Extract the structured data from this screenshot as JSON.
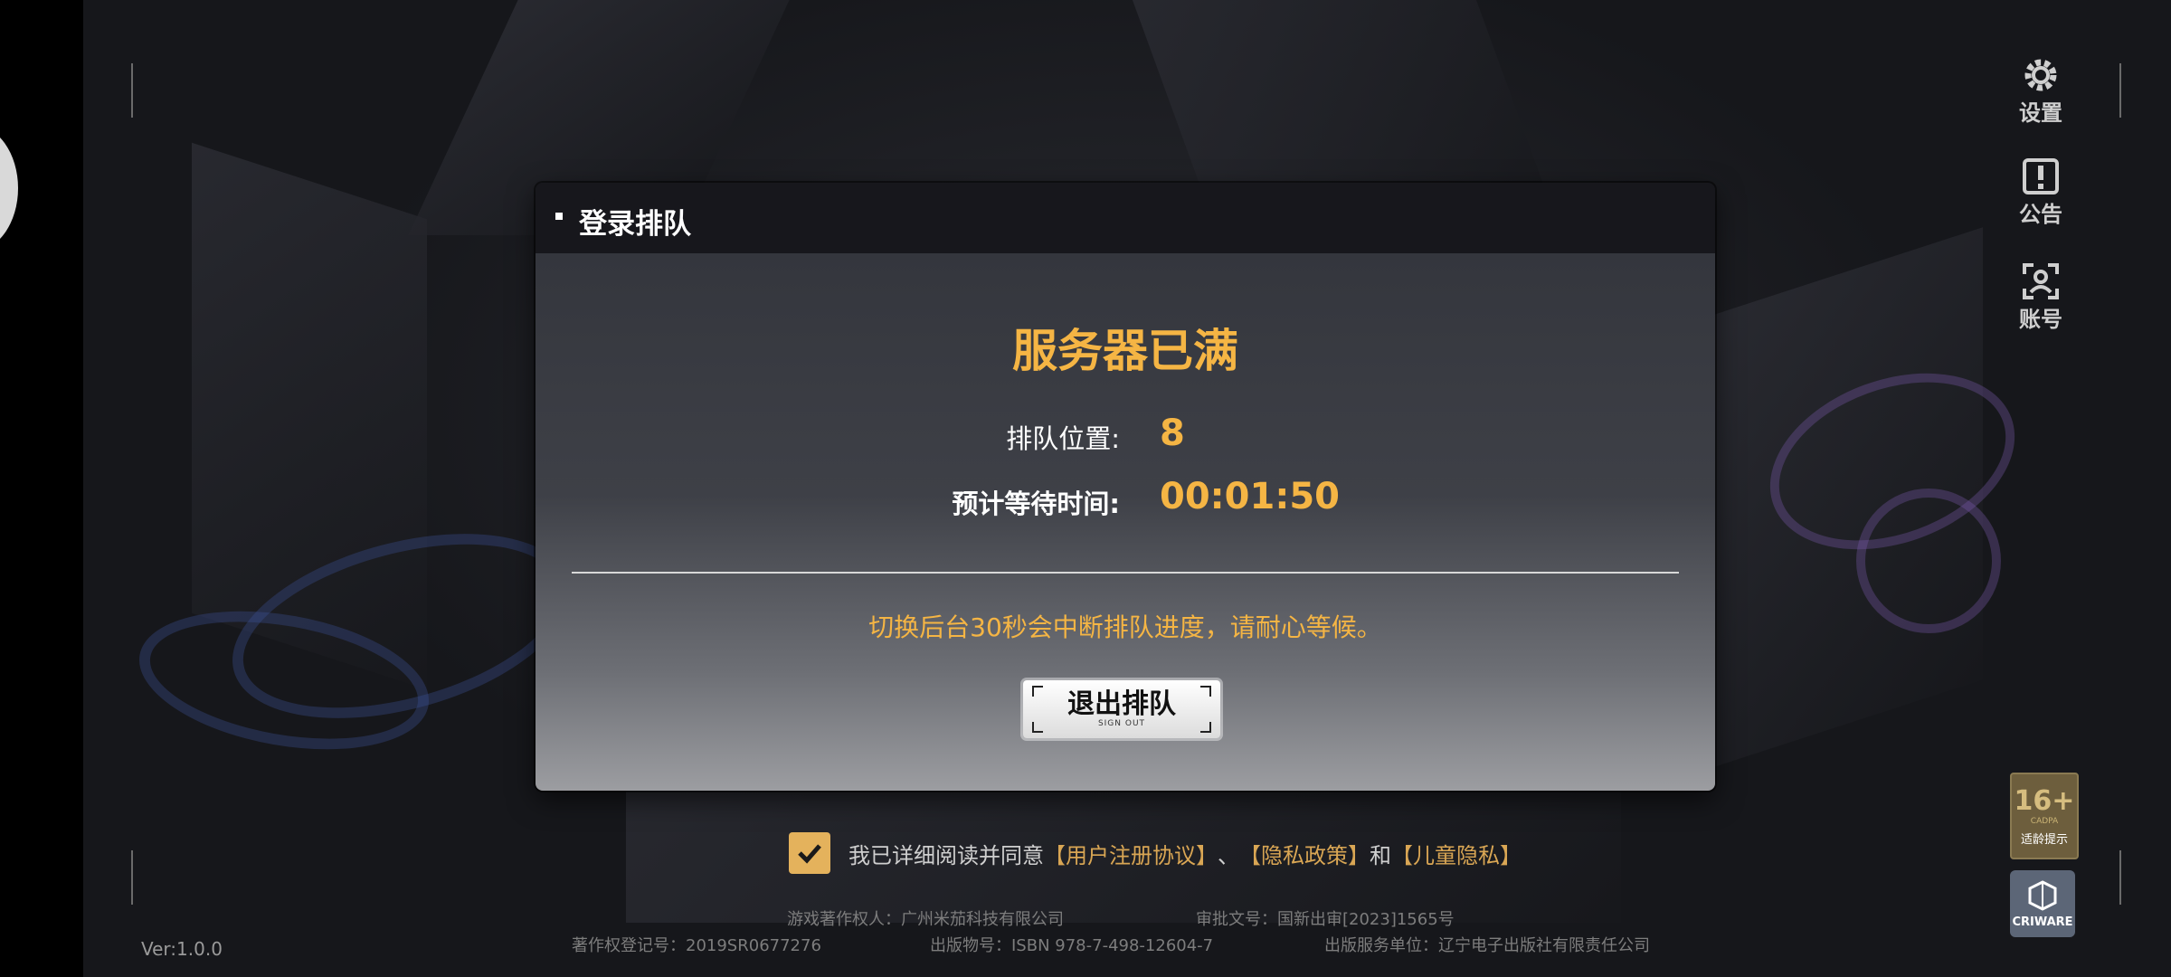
{
  "dialog": {
    "title": "登录排队",
    "status": "服务器已满",
    "queue_label": "排队位置:",
    "queue_value": "8",
    "wait_label": "预计等待时间:",
    "wait_value": "00:01:50",
    "notice": "切换后台30秒会中断排队进度，请耐心等候。",
    "exit_button": "退出排队",
    "exit_button_sub": "SIGN OUT"
  },
  "side_menu": {
    "settings": "设置",
    "notice": "公告",
    "account": "账号"
  },
  "agreement": {
    "prefix": "我已详细阅读并同意",
    "terms": "【用户注册协议】",
    "sep": "、",
    "privacy": "【隐私政策】",
    "and": "和",
    "child_privacy": "【儿童隐私】"
  },
  "footer": {
    "copyright_owner": "游戏著作权人：广州米茄科技有限公司",
    "approval": "审批文号：国新出审[2023]1565号",
    "registration": "著作权登记号：2019SR0677276",
    "publication": "出版物号：ISBN 978-7-498-12604-7",
    "publisher": "出版服务单位：辽宁电子出版社有限责任公司"
  },
  "version": "Ver:1.0.0",
  "age_badge": {
    "rating": "16+",
    "label": "CADPA",
    "tip": "适龄提示"
  },
  "criware": "CRIWARE",
  "colors": {
    "accent": "#f5b544",
    "header": "#17171c"
  },
  "icons": [
    "gear-icon",
    "alert-icon",
    "account-icon",
    "checkmark-icon"
  ]
}
